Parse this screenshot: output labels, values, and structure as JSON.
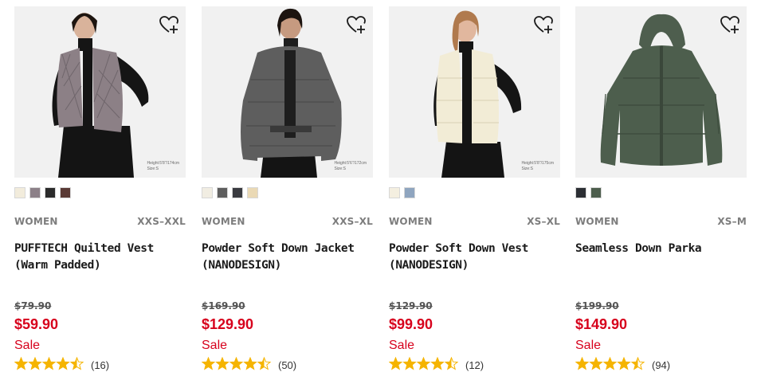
{
  "colors": {
    "sale_red": "#d7001c",
    "star_gold": "#f5b400",
    "muted_gray": "#7d7d7d"
  },
  "products": [
    {
      "gender": "WOMEN",
      "sizes": "XXS–XXL",
      "name": "PUFFTECH Quilted Vest (Warm Padded)",
      "old_price": "$79.90",
      "price": "$59.90",
      "sale": "Sale",
      "rating": 4.5,
      "reviews": "(16)",
      "model_note": [
        "Height:5'8\"/174cm",
        "Size:S"
      ],
      "swatches": [
        "#f2ecdc",
        "#8c8088",
        "#2b2b2b",
        "#5a3a35"
      ],
      "icon": "heart-plus-icon"
    },
    {
      "gender": "WOMEN",
      "sizes": "XXS–XL",
      "name": "Powder Soft Down Jacket (NANODESIGN)",
      "old_price": "$169.90",
      "price": "$129.90",
      "sale": "Sale",
      "rating": 4.5,
      "reviews": "(50)",
      "model_note": [
        "Height:5'6\"/172cm",
        "Size:S"
      ],
      "swatches": [
        "#f1ede2",
        "#5e5e5e",
        "#3a3b40",
        "#ead9b5"
      ],
      "icon": "heart-plus-icon"
    },
    {
      "gender": "WOMEN",
      "sizes": "XS–XL",
      "name": "Powder Soft Down Vest (NANODESIGN)",
      "old_price": "$129.90",
      "price": "$99.90",
      "sale": "Sale",
      "rating": 4.5,
      "reviews": "(12)",
      "model_note": [
        "Height:5'8\"/175cm",
        "Size:S"
      ],
      "swatches": [
        "#f4efe0",
        "#8fa5bf"
      ],
      "icon": "heart-plus-icon"
    },
    {
      "gender": "WOMEN",
      "sizes": "XS–M",
      "name": "Seamless Down Parka",
      "old_price": "$199.90",
      "price": "$149.90",
      "sale": "Sale",
      "rating": 4.5,
      "reviews": "(94)",
      "model_note": [],
      "swatches": [
        "#2c2f34",
        "#4d5e4d"
      ],
      "icon": "heart-plus-icon"
    }
  ]
}
